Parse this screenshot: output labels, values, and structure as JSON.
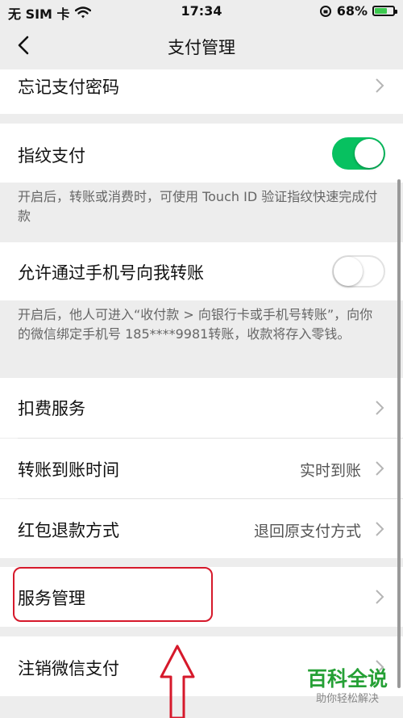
{
  "status_bar": {
    "carrier": "无 SIM 卡",
    "time": "17:34",
    "battery": "68%",
    "battery_level": 0.68,
    "icons": [
      "wifi-icon",
      "orientation-lock-icon",
      "battery-icon"
    ]
  },
  "nav": {
    "title": "支付管理",
    "back_icon": "chevron-left-icon"
  },
  "rows": {
    "forgot_password": "忘记支付密码",
    "fingerprint": "指纹支付",
    "fingerprint_desc": "开启后，转账或消费时，可使用 Touch ID 验证指纹快速完成付款",
    "phone_transfer": "允许通过手机号向我转账",
    "phone_transfer_desc": "开启后，他人可进入“收付款 > 向银行卡或手机号转账”，向你的微信绑定手机号 185****9981转账，收款将存入零钱。",
    "deduction_service": "扣费服务",
    "transfer_time": "转账到账时间",
    "transfer_time_value": "实时到账",
    "red_packet_refund": "红包退款方式",
    "red_packet_refund_value": "退回原支付方式",
    "service_management": "服务管理",
    "close_wechat_pay": "注销微信支付"
  },
  "toggles": {
    "fingerprint_on": true,
    "phone_transfer_on": false
  },
  "colors": {
    "toggle_on": "#07c160",
    "highlight": "#d6192b",
    "watermark": "#25a035"
  },
  "watermark": {
    "brand": "百科全说",
    "slogan": "助你轻松解决"
  }
}
